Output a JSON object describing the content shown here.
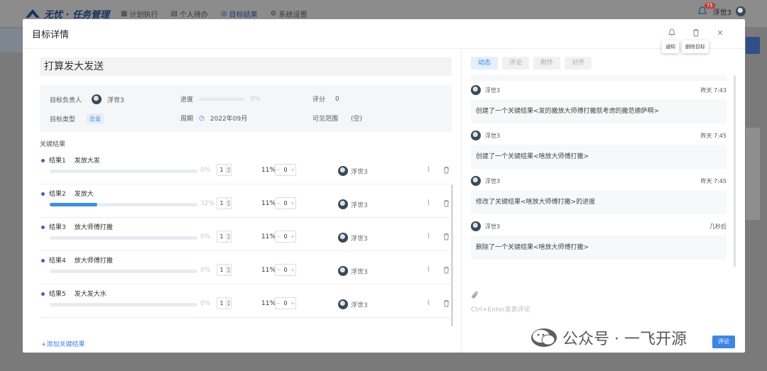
{
  "app": {
    "logo_text": "无忧 · 任务管理",
    "nav": [
      {
        "icon": "calendar-icon",
        "label": "计划执行"
      },
      {
        "icon": "clipboard-icon",
        "label": "个人待办"
      },
      {
        "icon": "target-icon",
        "label": "目标结果"
      },
      {
        "icon": "gear-icon",
        "label": "系统设置"
      }
    ],
    "notification_count": "75",
    "user_name": "浮世3"
  },
  "modal": {
    "title": "目标详情",
    "header_actions": [
      {
        "icon": "bell-icon",
        "tooltip": "通知"
      },
      {
        "icon": "trash-icon",
        "tooltip": "删除目标"
      },
      {
        "icon": "close-icon"
      }
    ]
  },
  "goal": {
    "title": "打算发大发送",
    "owner_label": "目标负责人",
    "owner": "浮世3",
    "progress_label": "进度",
    "progress": "0%",
    "score_label": "评分",
    "score": "0",
    "type_label": "目标类型",
    "type": "企业",
    "period_label": "周期",
    "period": "2022年09月",
    "visibility_label": "可见范围",
    "visibility": "(空)"
  },
  "key_results": {
    "section_label": "关键结果",
    "items": [
      {
        "index": "结果1",
        "name": "发放大发",
        "progress": 0,
        "progress_text": "0%",
        "value1": "1",
        "weight": "11%",
        "value2": "0",
        "owner": "浮世3"
      },
      {
        "index": "结果2",
        "name": "发放大",
        "progress": 32,
        "progress_text": "32%",
        "value1": "1",
        "weight": "11%",
        "value2": "0",
        "owner": "浮世3"
      },
      {
        "index": "结果3",
        "name": "放大师傅打撒",
        "progress": 0,
        "progress_text": "0%",
        "value1": "1",
        "weight": "11%",
        "value2": "0",
        "owner": "浮世3"
      },
      {
        "index": "结果4",
        "name": "放大师傅打撒",
        "progress": 0,
        "progress_text": "0%",
        "value1": "1",
        "weight": "11%",
        "value2": "0",
        "owner": "浮世3"
      },
      {
        "index": "结果5",
        "name": "发大发大水",
        "progress": 0,
        "progress_text": "0%",
        "value1": "1",
        "weight": "11%",
        "value2": "0",
        "owner": "浮世3"
      }
    ],
    "add_label": "+添加关键结果"
  },
  "activity": {
    "tabs": [
      {
        "label": "动态",
        "active": true
      },
      {
        "label": "评论",
        "active": false
      },
      {
        "label": "附件",
        "active": false
      },
      {
        "label": "对齐",
        "active": false
      }
    ],
    "items": [
      {
        "user": "浮世3",
        "time": "昨天 7:43",
        "text": "创建了一个关键结果<发的撒放大师傅打撒就考虑的撒范德萨啊>"
      },
      {
        "user": "浮世3",
        "time": "昨天 7:45",
        "text": "创建了一个关键结果<啥放大师傅打撒>"
      },
      {
        "user": "浮世3",
        "time": "昨天 7:45",
        "text": "修改了关键结果<啥放大师傅打撒>的进度"
      },
      {
        "user": "浮世3",
        "time": "几秒后",
        "text": "删除了一个关键结果<啥放大师傅打撒>"
      }
    ],
    "comment_placeholder": "Ctrl+Enter发表评论",
    "send_label": "评论"
  },
  "watermark": {
    "text": "公众号 · 一飞开源"
  }
}
